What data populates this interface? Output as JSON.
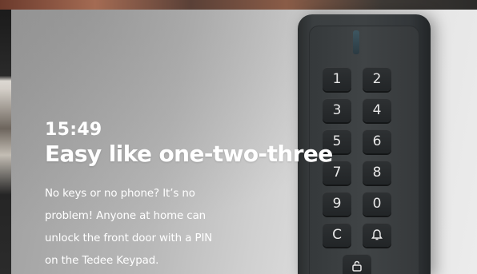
{
  "status": {
    "time": "15:49"
  },
  "hero": {
    "headline": "Easy like one-two-three",
    "body_lines": [
      "No keys or no phone? It’s no",
      "problem! Anyone at home can",
      "unlock the front door with a  PIN",
      "on the Tedee Keypad."
    ]
  },
  "keypad": {
    "keys": [
      "1",
      "2",
      "3",
      "4",
      "5",
      "6",
      "7",
      "8",
      "9",
      "0",
      "C"
    ],
    "bell_icon": "bell-icon",
    "lock_icon": "unlock-icon"
  }
}
